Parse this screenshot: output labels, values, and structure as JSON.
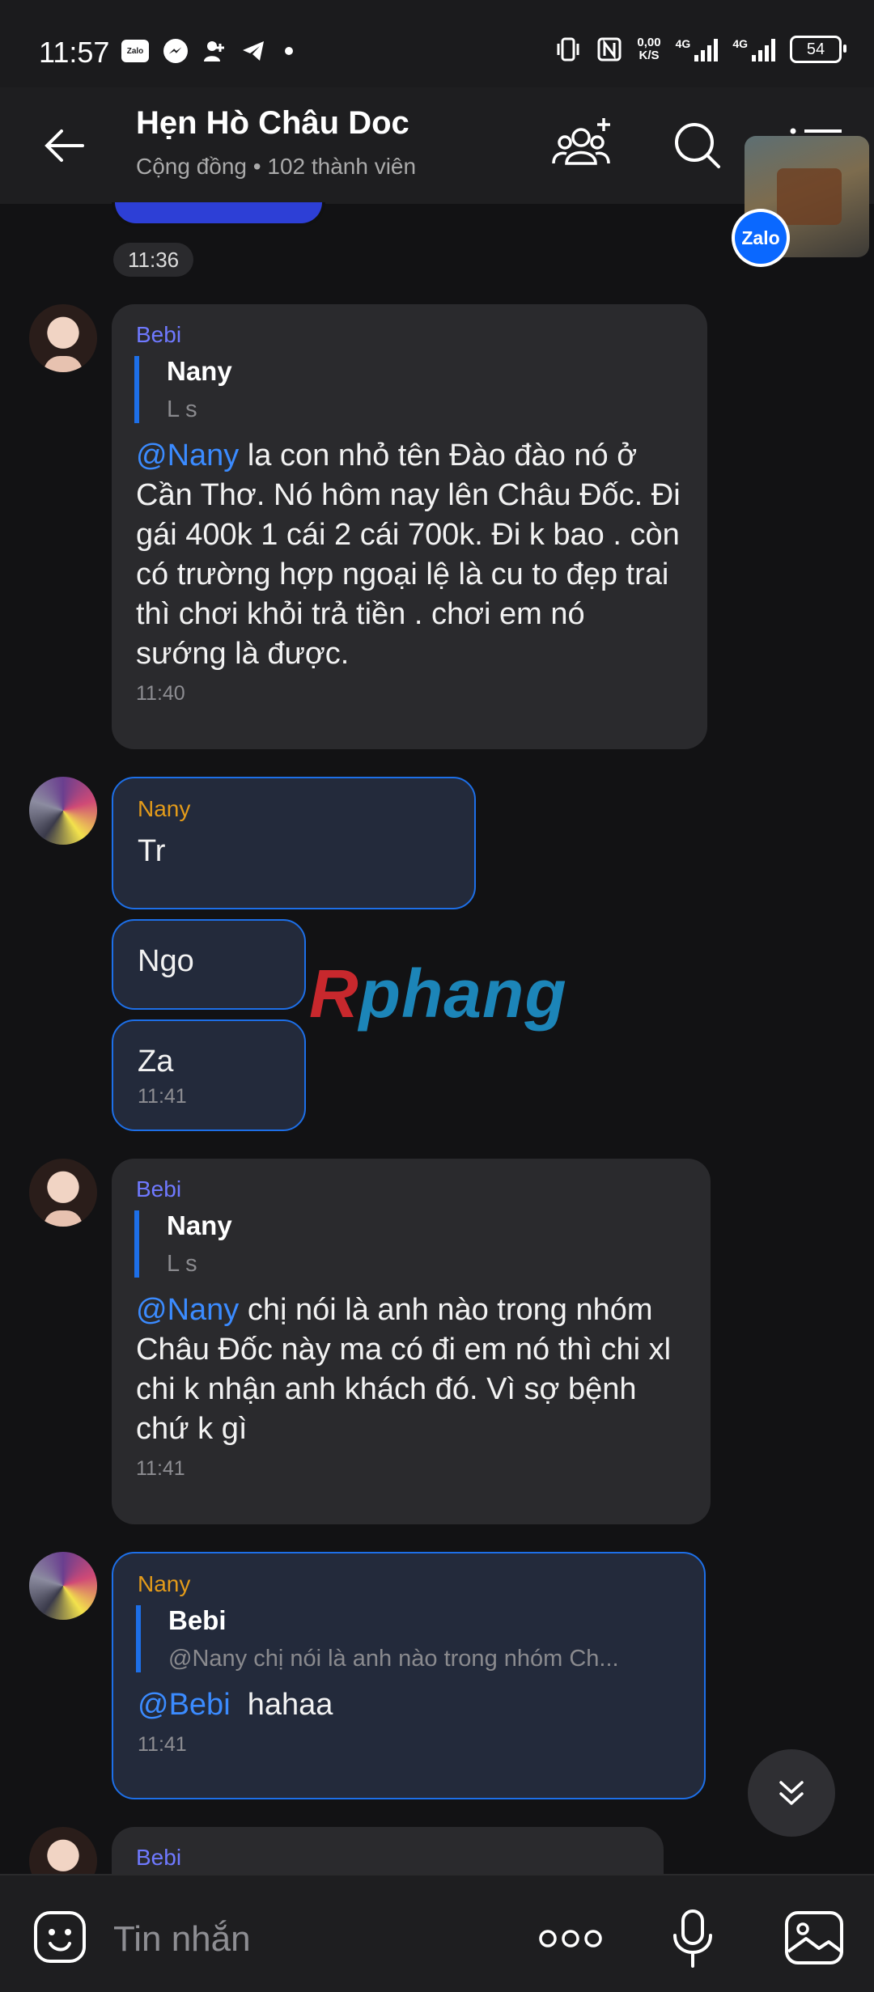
{
  "status_bar": {
    "time": "11:57",
    "zalo_label": "Zalo",
    "net_speed_top": "0,00",
    "net_speed_bottom": "K/S",
    "signal1_label": "4G",
    "signal2_label": "4G",
    "battery": "54"
  },
  "header": {
    "title": "Hẹn Hò Châu Doc",
    "subtitle": "Cộng đồng • 102 thành viên"
  },
  "pip": {
    "badge": "Zalo"
  },
  "time_separator": "11:36",
  "messages": [
    {
      "sender": "Bebi",
      "quote_name": "Nany",
      "quote_text": "L s",
      "mention": "@Nany",
      "text": " la con nhỏ tên Đào đào nó ở Cần Thơ. Nó hôm nay lên Châu Đốc. Đi gái 400k 1 cái 2 cái 700k. Đi k bao . còn có trường hợp ngoại lệ là cu to đẹp trai thì chơi khỏi trả tiền . chơi em nó sướng là được.",
      "time": "11:40"
    },
    {
      "sender": "Nany",
      "text": "Tr"
    },
    {
      "text": "Ngo"
    },
    {
      "text": "Za",
      "time": "11:41"
    },
    {
      "sender": "Bebi",
      "quote_name": "Nany",
      "quote_text": "L s",
      "mention": "@Nany",
      "text": " chị nói là anh nào trong nhóm Châu Đốc này ma có đi em nó thì chi xl chi k nhận anh khách đó. Vì sợ bệnh chứ k gì",
      "time": "11:41"
    },
    {
      "sender": "Nany",
      "quote_name": "Bebi",
      "quote_text": "@Nany chị nói là anh nào trong nhóm Ch...",
      "mention": "@Bebi",
      "text": "  hahaa",
      "time": "11:41"
    },
    {
      "sender": "Bebi"
    }
  ],
  "watermark": {
    "r": "R",
    "rest": "phang"
  },
  "input": {
    "placeholder": "Tin nhắn"
  },
  "colors": {
    "accent": "#1d6fe8",
    "bebi_name": "#6f79ff",
    "nany_name": "#e39b1a",
    "mention": "#3b8bff"
  }
}
